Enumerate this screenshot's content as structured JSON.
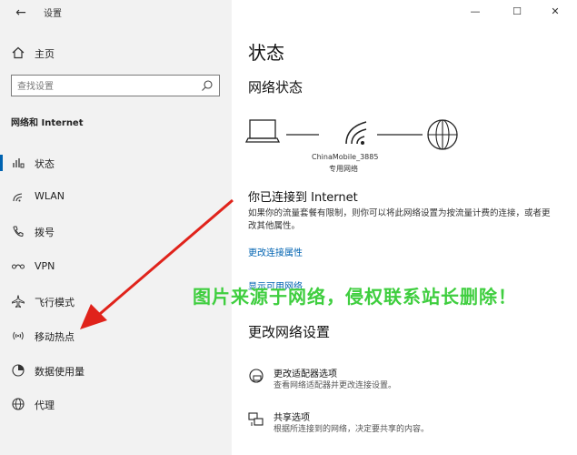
{
  "window": {
    "title": "设置",
    "controls": {
      "minimize": "—",
      "maximize": "☐",
      "close": "✕"
    }
  },
  "sidebar": {
    "home_label": "主页",
    "search_placeholder": "查找设置",
    "section_header": "网络和 Internet",
    "items": [
      {
        "label": "状态",
        "icon": "home-status-icon",
        "active": true
      },
      {
        "label": "WLAN",
        "icon": "wifi-icon",
        "active": false
      },
      {
        "label": "拨号",
        "icon": "phone-icon",
        "active": false
      },
      {
        "label": "VPN",
        "icon": "vpn-icon",
        "active": false
      },
      {
        "label": "飞行模式",
        "icon": "airplane-icon",
        "active": false
      },
      {
        "label": "移动热点",
        "icon": "hotspot-icon",
        "active": false
      },
      {
        "label": "数据使用量",
        "icon": "data-usage-icon",
        "active": false
      },
      {
        "label": "代理",
        "icon": "globe-icon",
        "active": false
      }
    ]
  },
  "main": {
    "title": "状态",
    "network_status_title": "网络状态",
    "network_name": "ChinaMobile_3885",
    "network_type": "专用网络",
    "connected_title": "你已连接到 Internet",
    "connected_desc": "如果你的流量套餐有限制，则你可以将此网络设置为按流量计费的连接，或者更改其他属性。",
    "link_change_props": "更改连接属性",
    "link_show_available": "显示可用网络",
    "change_settings_title": "更改网络设置",
    "settings": [
      {
        "title": "更改适配器选项",
        "desc": "查看网络适配器并更改连接设置。"
      },
      {
        "title": "共享选项",
        "desc": "根据所连接到的网络，决定要共享的内容。"
      }
    ]
  },
  "watermark": "图片来源于网络，侵权联系站长删除！",
  "colors": {
    "accent": "#0063b1",
    "sidebar_bg": "#f2f2f2",
    "watermark": "#3fce3f",
    "arrow": "#e0231b"
  }
}
